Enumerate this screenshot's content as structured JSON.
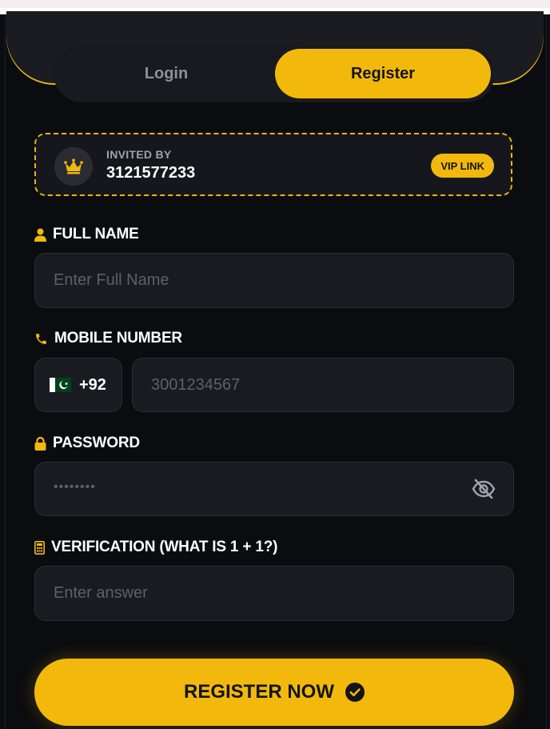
{
  "tabs": {
    "login": "Login",
    "register": "Register",
    "active": "register"
  },
  "invite": {
    "label": "INVITED BY",
    "code": "3121577233",
    "badge": "VIP LINK",
    "icon": "crown-icon"
  },
  "form": {
    "full_name": {
      "label": "FULL NAME",
      "placeholder": "Enter Full Name",
      "icon": "user-icon"
    },
    "mobile": {
      "label": "MOBILE NUMBER",
      "country_code": "+92",
      "placeholder": "3001234567",
      "icon": "phone-icon",
      "flag": "pakistan-flag-icon"
    },
    "password": {
      "label": "PASSWORD",
      "masked_value": "••••••••",
      "icon": "lock-icon",
      "toggle_icon": "eye-off-icon"
    },
    "verification": {
      "label": "VERIFICATION (WHAT IS 1 + 1?)",
      "placeholder": "Enter answer",
      "icon": "calculator-icon"
    }
  },
  "submit": {
    "label": "REGISTER NOW",
    "icon": "check-circle-icon"
  },
  "colors": {
    "accent": "#f2b90c",
    "background": "#0c0d10",
    "field": "#1a1b20",
    "muted": "#8c909b"
  }
}
